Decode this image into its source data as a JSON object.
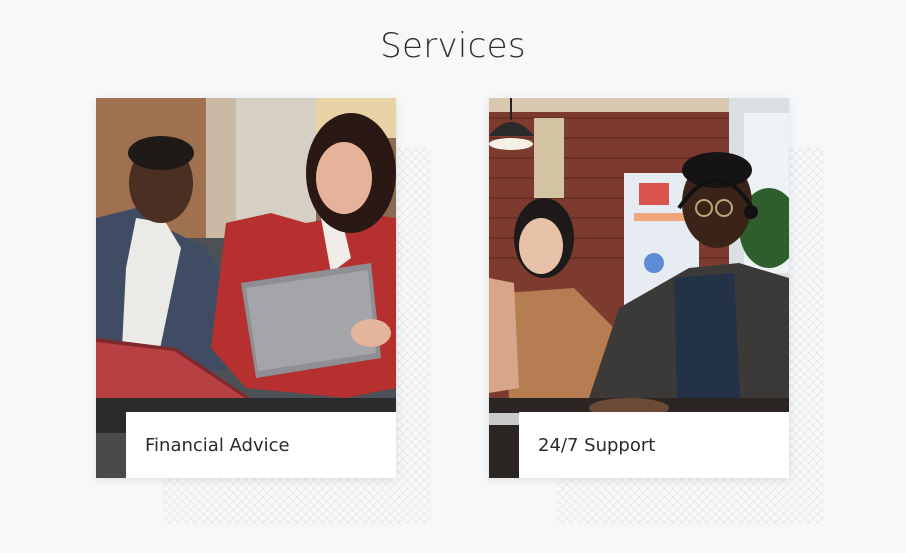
{
  "section": {
    "title": "Services"
  },
  "services": [
    {
      "label": "Financial Advice",
      "image": "two-people-reviewing-documents-photo"
    },
    {
      "label": "24/7 Support",
      "image": "call-center-agents-with-headsets-photo"
    }
  ]
}
